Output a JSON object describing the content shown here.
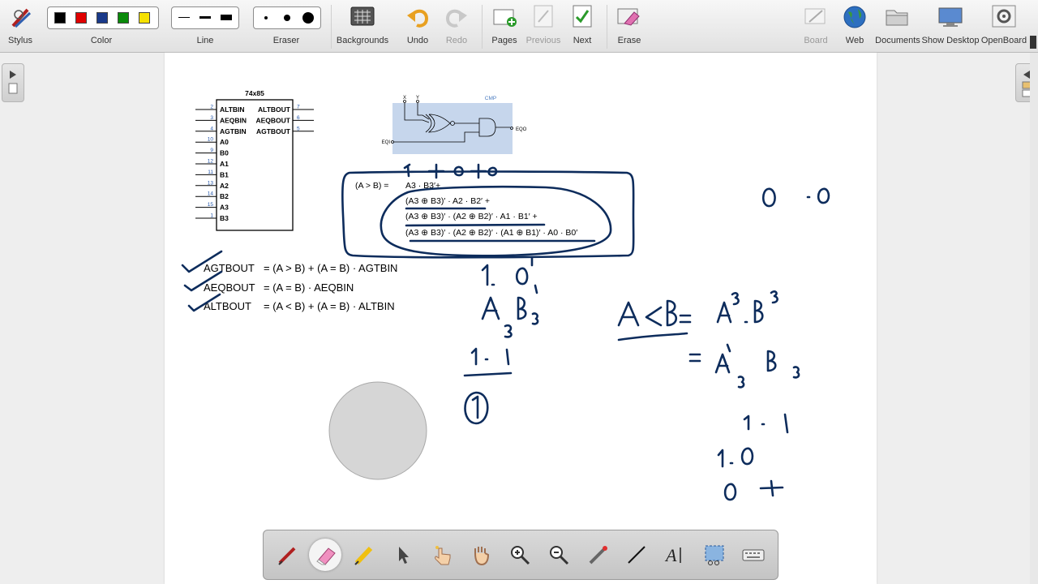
{
  "toolbar": {
    "stylus_label": "Stylus",
    "color_label": "Color",
    "colors": [
      "#000000",
      "#e00000",
      "#1a3a8a",
      "#0a8a0a",
      "#f5e100"
    ],
    "line_label": "Line",
    "eraser_label": "Eraser",
    "backgrounds_label": "Backgrounds",
    "undo_label": "Undo",
    "redo_label": "Redo",
    "pages_label": "Pages",
    "previous_label": "Previous",
    "next_label": "Next",
    "erase_label": "Erase",
    "board_label": "Board",
    "web_label": "Web",
    "documents_label": "Documents",
    "show_desktop_label": "Show Desktop",
    "openboard_label": "OpenBoard"
  },
  "chip": {
    "title": "74x85",
    "left_pins": [
      {
        "num": "2",
        "name": "ALTBIN"
      },
      {
        "num": "3",
        "name": "AEQBIN"
      },
      {
        "num": "4",
        "name": "AGTBIN"
      },
      {
        "num": "10",
        "name": "A0"
      },
      {
        "num": "9",
        "name": "B0"
      },
      {
        "num": "12",
        "name": "A1"
      },
      {
        "num": "11",
        "name": "B1"
      },
      {
        "num": "13",
        "name": "A2"
      },
      {
        "num": "14",
        "name": "B2"
      },
      {
        "num": "15",
        "name": "A3"
      },
      {
        "num": "1",
        "name": "B3"
      }
    ],
    "right_pins": [
      {
        "num": "7",
        "name": "ALTBOUT"
      },
      {
        "num": "6",
        "name": "AEQBOUT"
      },
      {
        "num": "5",
        "name": "AGTBOUT"
      }
    ]
  },
  "cmp": {
    "title": "CMP",
    "x_label": "X",
    "y_label": "Y",
    "eqi_label": "EQI",
    "eqo_label": "EQO"
  },
  "equation": {
    "lhs": "(A > B)  =",
    "line1": "A3 · B3′+",
    "line2": "(A3 ⊕ B3)′ · A2 · B2′ +",
    "line3": "(A3 ⊕ B3)′ · (A2 ⊕ B2)′ · A1 · B1′ +",
    "line4": "(A3 ⊕ B3)′ · (A2 ⊕ B2)′ · (A1 ⊕ B1)′ · A0 · B0′"
  },
  "outputs": [
    {
      "name": "AGTBOUT",
      "expr": "=  (A > B) + (A = B) · AGTBIN"
    },
    {
      "name": "AEQBOUT",
      "expr": "=  (A = B) · AEQBIN"
    },
    {
      "name": "ALTBOUT",
      "expr": "=  (A < B) + (A = B) · ALTBIN"
    }
  ],
  "bottom_tools": [
    "pen-tool",
    "eraser-tool",
    "highlighter-tool",
    "selector-tool",
    "interactor-tool",
    "hand-tool",
    "zoom-in-tool",
    "zoom-out-tool",
    "laser-pointer-tool",
    "line-tool",
    "text-tool",
    "capture-tool",
    "keyboard-tool"
  ],
  "ink_color": "#0d2c5c"
}
